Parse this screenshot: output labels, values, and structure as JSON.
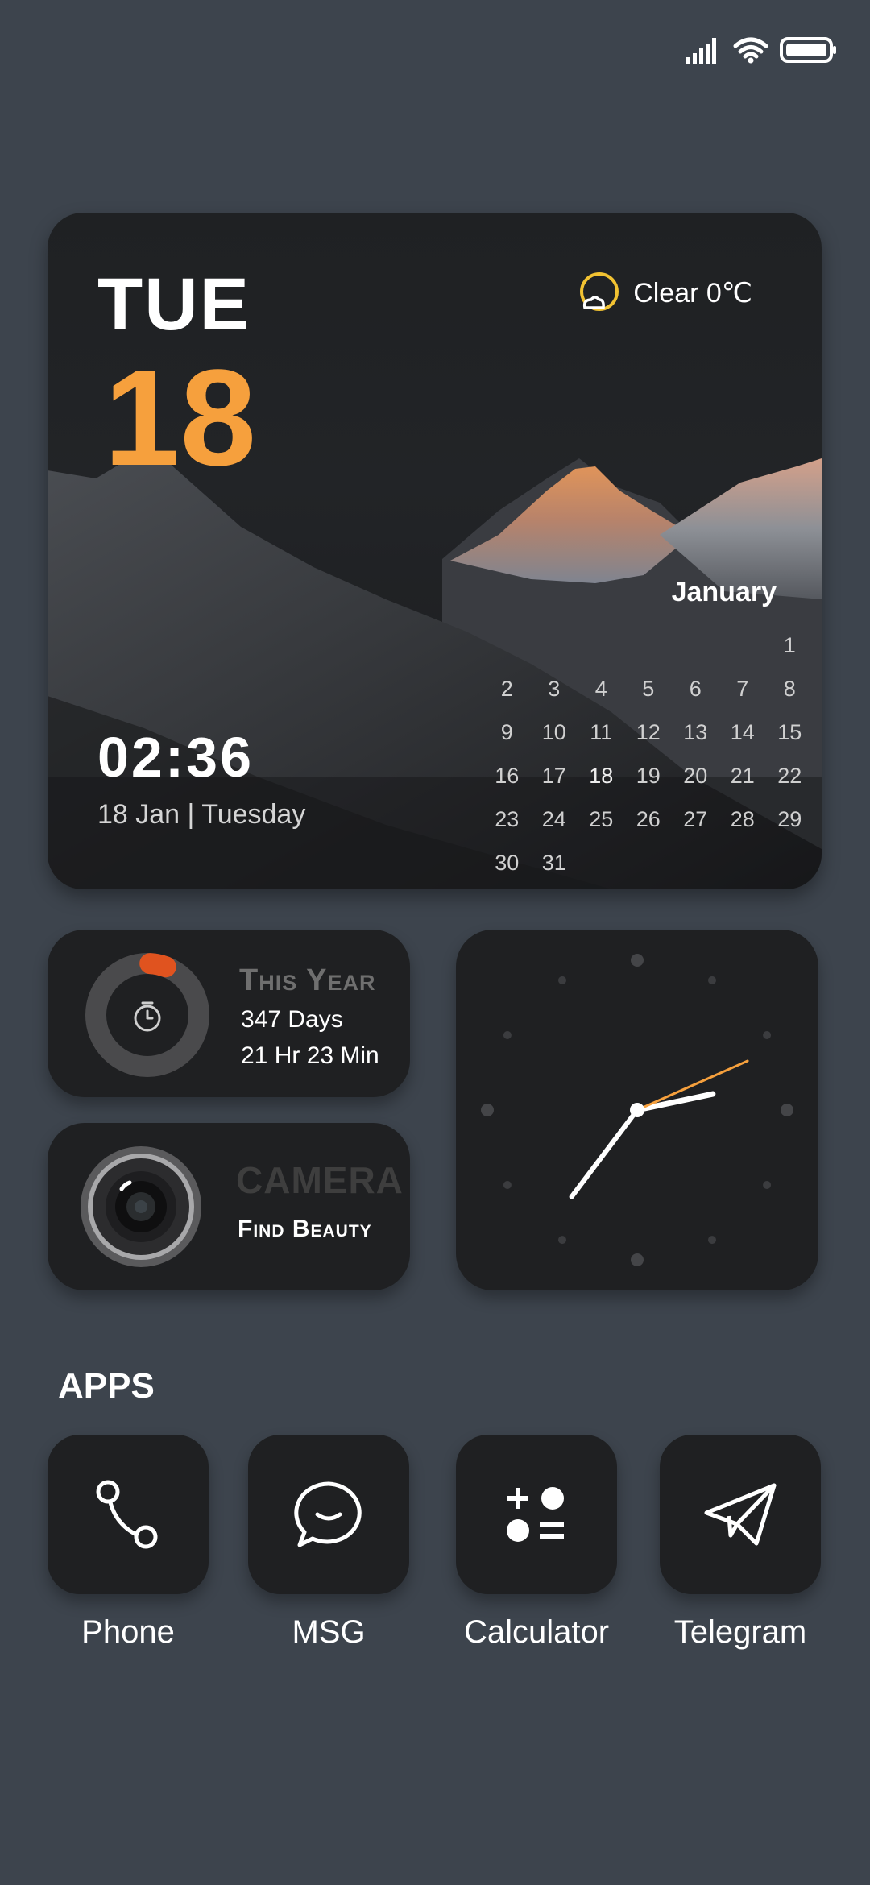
{
  "status_bar": {
    "icons": [
      "signal-icon",
      "wifi-icon",
      "battery-icon"
    ]
  },
  "main_widget": {
    "day_name": "TUE",
    "day_number": "18",
    "weather": {
      "icon": "clear-night-icon",
      "text": "Clear 0℃"
    },
    "time": "02:36",
    "date_line": "18 Jan | Tuesday",
    "calendar": {
      "month": "January",
      "weeks": [
        [
          "",
          "",
          "",
          "",
          "",
          "",
          "1"
        ],
        [
          "2",
          "3",
          "4",
          "5",
          "6",
          "7",
          "8"
        ],
        [
          "9",
          "10",
          "11",
          "12",
          "13",
          "14",
          "15"
        ],
        [
          "16",
          "17",
          "18",
          "19",
          "20",
          "21",
          "22"
        ],
        [
          "23",
          "24",
          "25",
          "26",
          "27",
          "28",
          "29"
        ],
        [
          "30",
          "31",
          "",
          "",
          "",
          "",
          ""
        ]
      ],
      "today": "18"
    }
  },
  "year_widget": {
    "title": "This Year",
    "line1": "347 Days",
    "line2": "21 Hr 23 Min",
    "progress_fraction": 0.05,
    "icon": "timer-icon"
  },
  "camera_widget": {
    "title": "CAMERA",
    "subtitle": "Find Beauty",
    "icon": "camera-lens-icon"
  },
  "analog_clock": {
    "hour": 2,
    "minute": 36,
    "second": 11
  },
  "apps_section": {
    "title": "APPS",
    "items": [
      {
        "label": "Phone",
        "icon": "phone-icon"
      },
      {
        "label": "MSG",
        "icon": "message-icon"
      },
      {
        "label": "Calculator",
        "icon": "calculator-icon"
      },
      {
        "label": "Telegram",
        "icon": "telegram-icon"
      }
    ]
  },
  "colors": {
    "background": "#3d444d",
    "widget": "#1f2022",
    "accent": "#f6a03d",
    "progress": "#e0531f"
  }
}
